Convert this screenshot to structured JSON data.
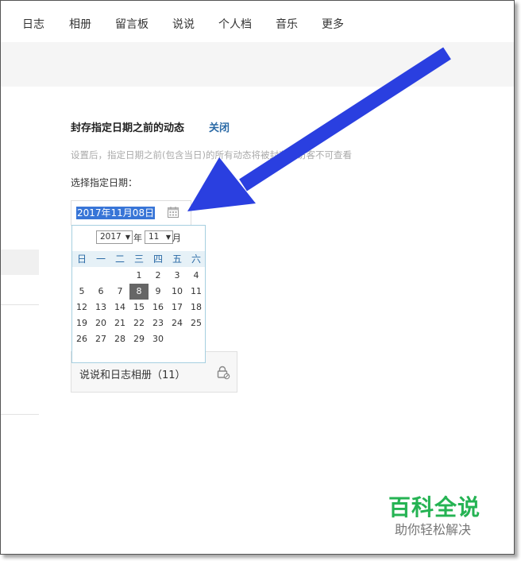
{
  "nav": {
    "items": [
      "日志",
      "相册",
      "留言板",
      "说说",
      "个人档",
      "音乐",
      "更多"
    ]
  },
  "section": {
    "title": "封存指定日期之前的动态",
    "close_label": "关闭",
    "hint": "设置后，指定日期之前(包含当日)的所有动态将被封存，访客不可查看",
    "date_label": "选择指定日期："
  },
  "date_input": {
    "value": "2017年11月08日"
  },
  "calendar": {
    "year": "2017",
    "year_suffix": "年",
    "month": "11",
    "month_suffix": "月",
    "weekdays": [
      "日",
      "一",
      "二",
      "三",
      "四",
      "五",
      "六"
    ],
    "weeks": [
      [
        "",
        "",
        "",
        "1",
        "2",
        "3",
        "4"
      ],
      [
        "5",
        "6",
        "7",
        "8",
        "9",
        "10",
        "11"
      ],
      [
        "12",
        "13",
        "14",
        "15",
        "16",
        "17",
        "18"
      ],
      [
        "19",
        "20",
        "21",
        "22",
        "23",
        "24",
        "25"
      ],
      [
        "26",
        "27",
        "28",
        "29",
        "30",
        "",
        ""
      ]
    ],
    "selected_day": "8"
  },
  "album": {
    "label": "说说和日志相册（11）"
  },
  "watermark": {
    "title": "百科全说",
    "subtitle": "助你轻松解决"
  },
  "colors": {
    "accent_link": "#2b6aa6",
    "annotation_arrow": "#2a3fe0",
    "watermark_green": "#25b353",
    "selection_highlight": "#3875d7"
  }
}
